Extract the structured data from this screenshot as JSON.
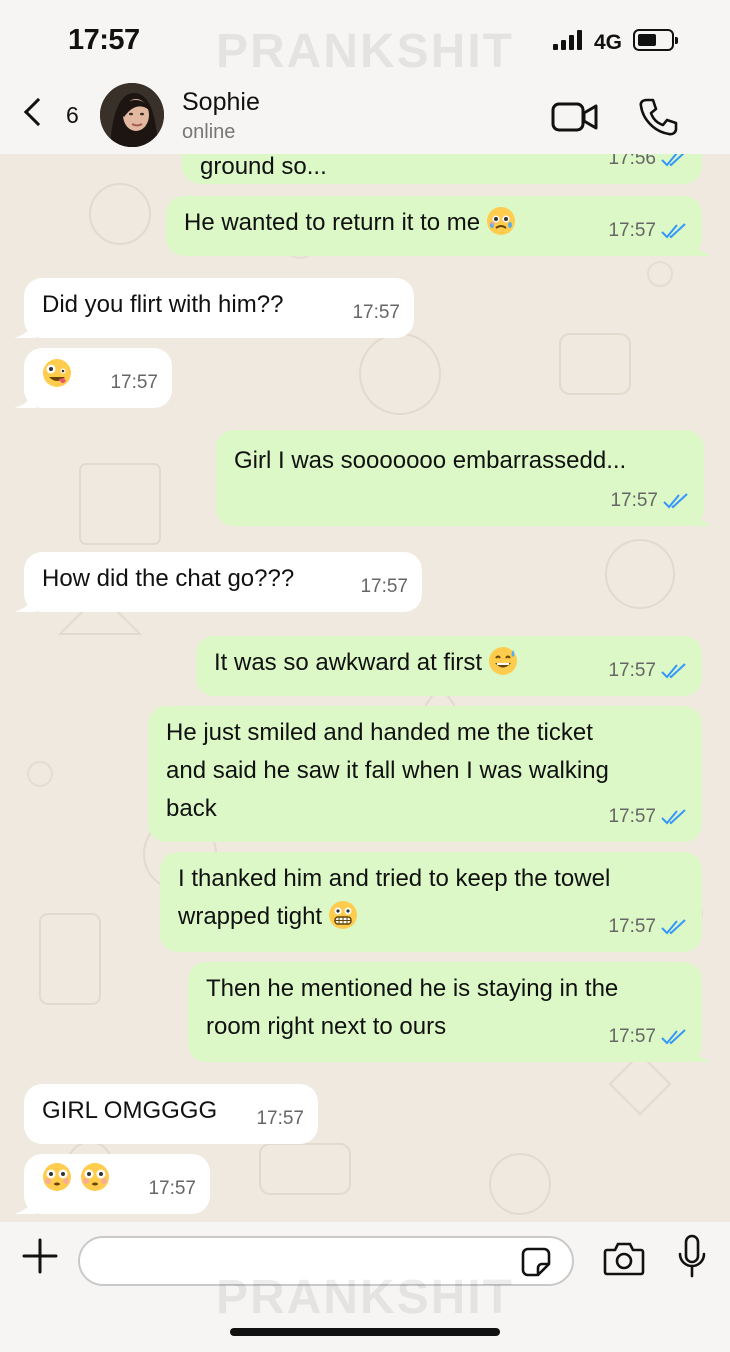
{
  "status_bar": {
    "time": "17:57",
    "network": "4G"
  },
  "watermark": "PRANKSHIT",
  "header": {
    "back_count": "6",
    "contact_name": "Sophie",
    "contact_status": "online"
  },
  "messages": [
    {
      "direction": "out",
      "text": "ground so...",
      "time": "17:56",
      "read": true
    },
    {
      "direction": "out",
      "text": "He wanted to return it to me",
      "emoji": "face-holding-back-tears",
      "time": "17:57",
      "read": true
    },
    {
      "direction": "in",
      "text": "Did you flirt with him??",
      "time": "17:57"
    },
    {
      "direction": "in",
      "emoji": "zany-face",
      "time": "17:57"
    },
    {
      "direction": "out",
      "text": "Girl I was sooooooo embarrassedd...",
      "time": "17:57",
      "read": true
    },
    {
      "direction": "in",
      "text": "How did the chat go???",
      "time": "17:57"
    },
    {
      "direction": "out",
      "text": "It was so awkward at first",
      "emoji": "grinning-face-with-sweat",
      "time": "17:57",
      "read": true
    },
    {
      "direction": "out",
      "text": "He just smiled and handed me the ticket\nand said he saw it fall when I was walking\nback",
      "time": "17:57",
      "read": true
    },
    {
      "direction": "out",
      "text": "I thanked him and tried to keep the towel\nwrapped tight",
      "emoji": "grimacing-face",
      "time": "17:57",
      "read": true
    },
    {
      "direction": "out",
      "text": "Then he mentioned he is staying in the\nroom right next to ours",
      "time": "17:57",
      "read": true
    },
    {
      "direction": "in",
      "text": "GIRL OMGGGG",
      "time": "17:57"
    },
    {
      "direction": "in",
      "emoji": "flushed-face flushed-face",
      "time": "17:57"
    }
  ],
  "composer": {
    "placeholder": ""
  },
  "colors": {
    "outgoing_bubble": "#dbf8c6",
    "incoming_bubble": "#ffffff",
    "read_ticks": "#3497f9",
    "chat_background": "#efe9df"
  }
}
